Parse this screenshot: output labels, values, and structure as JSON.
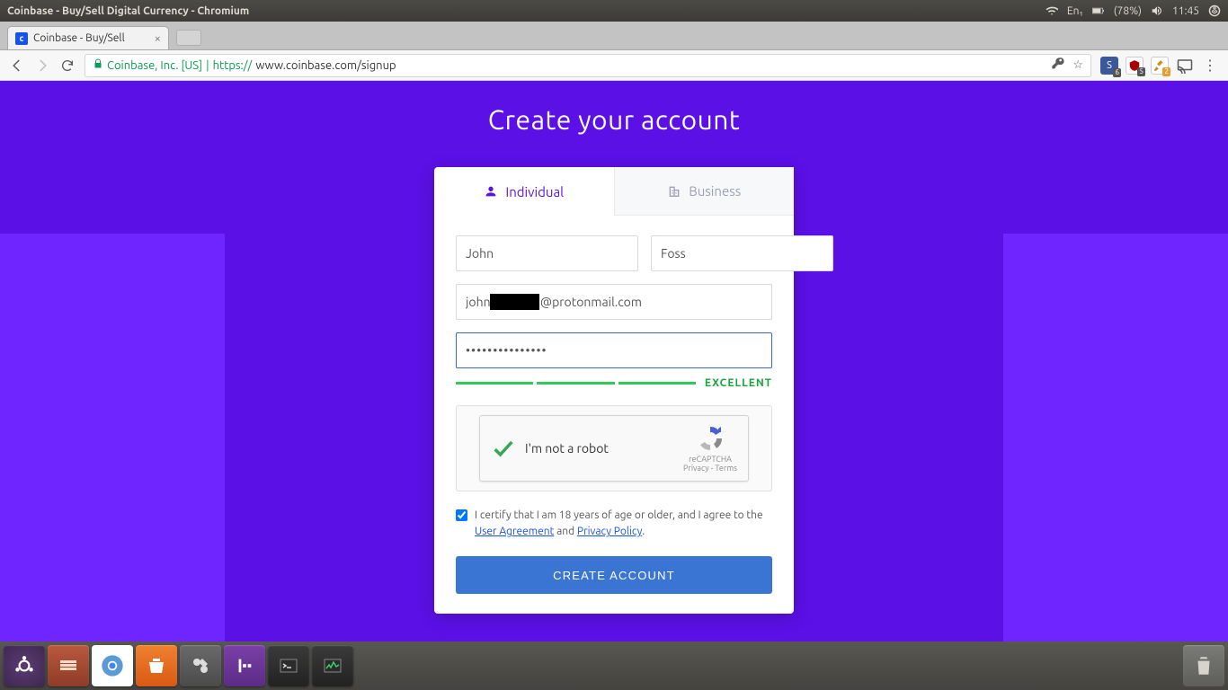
{
  "system": {
    "window_title": "Coinbase - Buy/Sell Digital Currency - Chromium",
    "lang": "En₁",
    "battery": "(78%)",
    "time": "11:45"
  },
  "browser": {
    "tab_title": "Coinbase - Buy/Sell",
    "company": "Coinbase, Inc. [US]",
    "url_proto": "https://",
    "url_rest": "www.coinbase.com/signup",
    "ext_badges": {
      "s": "6",
      "u": "5",
      "b": "2"
    }
  },
  "page": {
    "heading": "Create your account",
    "tabs": {
      "individual": "Individual",
      "business": "Business"
    },
    "first_name": "John",
    "last_name": "Foss",
    "email_prefix": "john",
    "email_suffix": "@protonmail.com",
    "password": "•••••••••••••••",
    "strength": "EXCELLENT",
    "captcha": {
      "text": "I'm not a robot",
      "brand": "reCAPTCHA",
      "legal": "Privacy - Terms"
    },
    "certify_pre": "I certify that I am 18 years of age or older, and I agree to the ",
    "ua": "User Agreement",
    "and": " and ",
    "pp": "Privacy Policy",
    "submit": "CREATE ACCOUNT"
  }
}
